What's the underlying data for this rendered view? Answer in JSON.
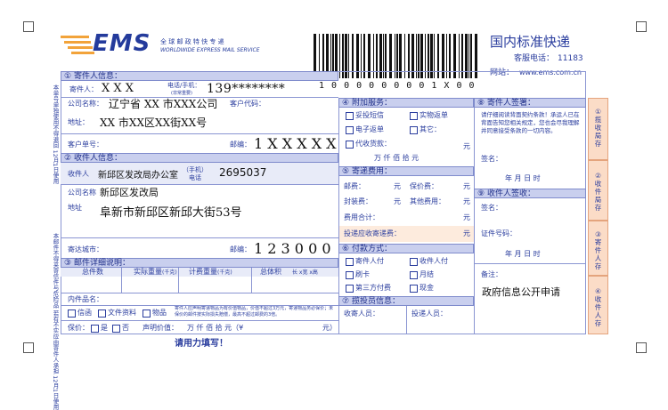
{
  "header": {
    "logo_text": "EMS",
    "logo_cn": "全 球 邮 政 特 快 专 递",
    "logo_en": "WORLDWIDE EXPRESS MAIL SERVICE",
    "barcode_number": "1 0 0 0 0 0 0 0 0 1 X 0 0",
    "service_title": "国内标准快递",
    "hotline_label": "客服电话：",
    "hotline": "11183",
    "website_label": "网站：",
    "website": "www.ems.com.cn"
  },
  "sender": {
    "section_title": "寄件人信息：",
    "name_label": "寄件人：",
    "name": "X X X",
    "phone_label": "电话/手机：",
    "phone_sub": "(非常重要)",
    "phone": "139********",
    "company_label": "公司名称：",
    "company": "辽宁省 XX 市XXX公司",
    "code_label": "客户代码：",
    "address_label": "地址：",
    "address": "XX 市XX区XX街XX号",
    "order_label": "客户单号：",
    "zip_label": "邮编：",
    "zip": "1 X X X X X"
  },
  "recipient": {
    "section_title": "收件人信息：",
    "name_label": "收件人",
    "name": "新邱区发改局办公室",
    "phone_label": "（手机）",
    "phone_sub": "电话",
    "phone": "2695037",
    "company_label": "公司名称",
    "company": "新邱区发改局",
    "address_label": "地址",
    "address": "阜新市新邱区新邱大街53号",
    "city_label": "寄达城市：",
    "zip_label": "邮编：",
    "zip": "1 2 3 0 0 0"
  },
  "item": {
    "section_title": "邮件详细说明：",
    "count_label": "总件数",
    "actual_weight_label": "实际重量",
    "actual_weight_unit": "(千克)",
    "charge_weight_label": "计费重量",
    "charge_weight_unit": "(千克)",
    "volume_label": "总体积",
    "volume_dims": "长  x宽  x高",
    "contents_label": "内件品名：",
    "types": [
      "信函",
      "文件资料",
      "物品"
    ],
    "notice": "寄件人应声明寄递物品为有价值物品，价值不超过3万元，寄递物品务必保价；未保价的邮件按实际损失赔偿，最高不超过邮费的3倍。",
    "insure_label": "保价：",
    "yes": "是",
    "no": "否",
    "declared_label": "声明价值：",
    "declared_units": "万  仟  佰  拾  元（¥",
    "declared_close": "元）",
    "footer": "请用力填写！"
  },
  "addon": {
    "section_title": "附加服务：",
    "options": [
      "妥投短信",
      "实物返单",
      "电子返单",
      "其它："
    ],
    "cod_label": "代收货款：",
    "yuan": "元",
    "amount_units": "万  仟  佰  拾  元"
  },
  "fees": {
    "section_title": "寄递费用：",
    "postage": "邮费：",
    "insure_fee": "保价费：",
    "packing_fee": "封装费：",
    "other_fee": "其他费用：",
    "total": "费用合计：",
    "delivery_fee": "投递应收寄递费：",
    "yuan": "元"
  },
  "payment": {
    "section_title": "付款方式：",
    "options": [
      "寄件人付",
      "收件人付",
      "刷卡",
      "月结",
      "第三方付费",
      "现金"
    ]
  },
  "staff": {
    "section_title": "揽投员信息：",
    "pickup": "收寄人员：",
    "delivery": "投递人员："
  },
  "sender_sign": {
    "section_title": "寄件人签署：",
    "text": "请仔细阅读背面契约条款！承运人已在背面告知您相关规定，您也会尽我理解并同意接受条款的一切内容。",
    "sign_label": "签名：",
    "date": "年    月    日    时"
  },
  "recipient_sign": {
    "section_title": "收件人签收：",
    "sign_label": "签名：",
    "id_label": "证件号码：",
    "date": "年    月    日    时",
    "remark_label": "备注：",
    "remark": "政府信息公开申请"
  },
  "side_tabs": [
    [
      "①",
      "揽",
      "收",
      "局",
      "存"
    ],
    [
      "②",
      "收",
      "件",
      "局",
      "存"
    ],
    [
      "③",
      "寄",
      "件",
      "人",
      "存"
    ],
    [
      "④",
      "收",
      "件",
      "人",
      "存"
    ]
  ],
  "side_tab_numbers": [
    "①",
    "②",
    "③",
    "④"
  ],
  "vertical_notes": [
    "本单号单独使用不得退回  12月1日使用",
    "本邮件不得夹寄信件与危险品  若有不实应由寄件人承担  12月1日使用"
  ]
}
